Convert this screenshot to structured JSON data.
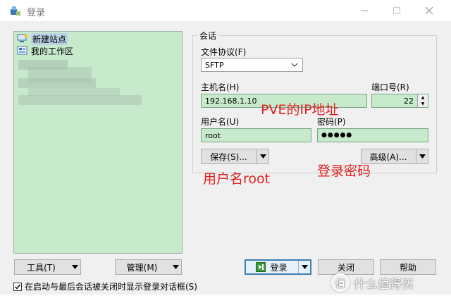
{
  "window": {
    "title": "登录",
    "icon": "winscp-login-icon",
    "controls": {
      "minimize": "minimize-icon",
      "maximize": "maximize-icon",
      "close": "close-icon"
    }
  },
  "site_tree": {
    "items": [
      {
        "label": "新建站点",
        "icon": "new-site-icon",
        "selected": true
      },
      {
        "label": "我的工作区",
        "icon": "workspace-icon",
        "selected": false
      }
    ]
  },
  "session": {
    "group_label": "会话",
    "protocol_label": "文件协议(F)",
    "protocol_value": "SFTP",
    "host_label": "主机名(H)",
    "host_value": "192.168.1.10",
    "port_label": "端口号(R)",
    "port_value": "22",
    "user_label": "用户名(U)",
    "user_value": "root",
    "password_label": "密码(P)",
    "password_value": "●●●●●",
    "save_label": "保存(S)...",
    "advanced_label": "高级(A)..."
  },
  "annotations": {
    "host_note": "PVE的IP地址",
    "user_note": "用户名root",
    "password_note": "登录密码"
  },
  "buttons": {
    "tools": "工具(T)",
    "manage": "管理(M)",
    "login": "登录",
    "close": "关闭",
    "help": "帮助"
  },
  "footer": {
    "checkbox_label": "在启动与最后会话被关闭时显示登录对话框(S)",
    "checkbox_checked": true
  },
  "watermark": {
    "logo": "值",
    "text": "什么值得买"
  },
  "colors": {
    "field_bg": "#c7e9cc",
    "annotation": "#e02020",
    "primary_border": "#3c7fb1"
  }
}
